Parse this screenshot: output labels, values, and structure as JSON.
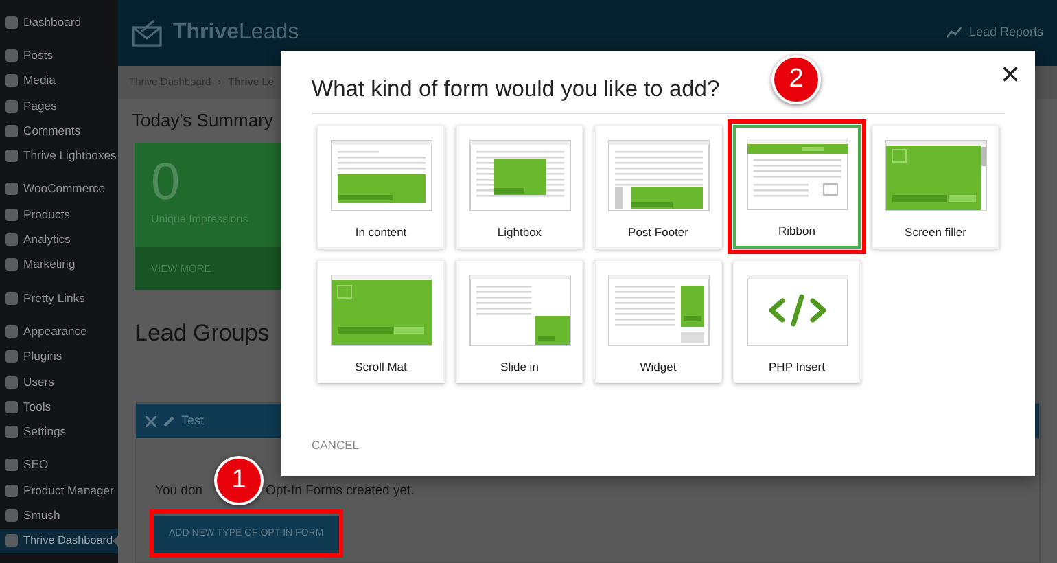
{
  "sidebar": {
    "groups": [
      [
        {
          "label": "Dashboard",
          "active": false
        }
      ],
      [
        {
          "label": "Posts",
          "active": false
        },
        {
          "label": "Media",
          "active": false
        },
        {
          "label": "Pages",
          "active": false
        },
        {
          "label": "Comments",
          "active": false
        },
        {
          "label": "Thrive Lightboxes",
          "active": false
        }
      ],
      [
        {
          "label": "WooCommerce",
          "active": false
        },
        {
          "label": "Products",
          "active": false
        },
        {
          "label": "Analytics",
          "active": false
        },
        {
          "label": "Marketing",
          "active": false
        }
      ],
      [
        {
          "label": "Pretty Links",
          "active": false
        }
      ],
      [
        {
          "label": "Appearance",
          "active": false
        },
        {
          "label": "Plugins",
          "active": false
        },
        {
          "label": "Users",
          "active": false
        },
        {
          "label": "Tools",
          "active": false
        },
        {
          "label": "Settings",
          "active": false
        }
      ],
      [
        {
          "label": "SEO",
          "active": false
        },
        {
          "label": "Product Manager",
          "active": false
        },
        {
          "label": "Smush",
          "active": false
        },
        {
          "label": "Thrive Dashboard",
          "active": true
        }
      ]
    ]
  },
  "header": {
    "logo_bold": "Thrive",
    "logo_light": "Leads",
    "reports_link": "Lead Reports"
  },
  "breadcrumbs": [
    "Thrive Dashboard",
    "›",
    "Thrive Le"
  ],
  "summary": {
    "title": "Today's Summary",
    "value": "0",
    "caption": "Unique Impressions",
    "link": "VIEW MORE"
  },
  "lead_groups": {
    "title": "Lead Groups",
    "group_name": "Test",
    "notice_start": "You don",
    "notice_end": "Opt-In Forms created yet.",
    "add_button": {
      "label": "ADD NEW TYPE OF OPT-IN FORM",
      "callout": "1"
    }
  },
  "modal": {
    "title": "What kind of form would you like to add?",
    "close": "×",
    "cancel": "CANCEL",
    "options": [
      {
        "kind": "in_content",
        "label": "In content",
        "selected": false
      },
      {
        "kind": "lightbox",
        "label": "Lightbox",
        "selected": false
      },
      {
        "kind": "post_footer",
        "label": "Post Footer",
        "selected": false
      },
      {
        "kind": "ribbon",
        "label": "Ribbon",
        "selected": true,
        "callout": "2"
      },
      {
        "kind": "screen_filler",
        "label": "Screen filler",
        "selected": false
      },
      {
        "kind": "scroll_mat",
        "label": "Scroll Mat",
        "selected": false
      },
      {
        "kind": "slide_in",
        "label": "Slide in",
        "selected": false
      },
      {
        "kind": "widget",
        "label": "Widget",
        "selected": false
      },
      {
        "kind": "php_insert",
        "label": "PHP Insert",
        "selected": false
      }
    ]
  }
}
